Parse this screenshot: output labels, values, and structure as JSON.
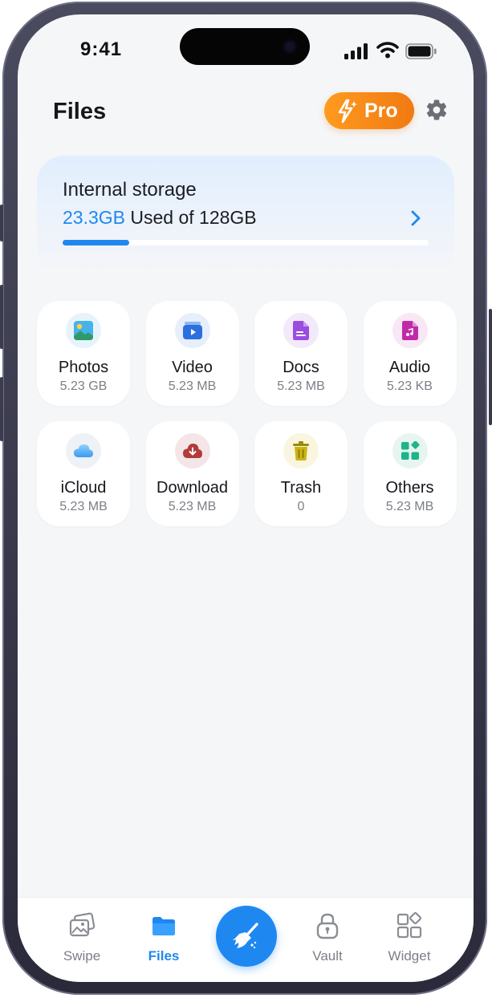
{
  "status_bar": {
    "time": "9:41"
  },
  "header": {
    "title": "Files",
    "pro_label": "Pro"
  },
  "storage": {
    "label": "Internal storage",
    "used_amount": "23.3GB",
    "used_suffix": " Used of 128GB",
    "used_fraction": 0.182
  },
  "categories": [
    {
      "name": "Photos",
      "size": "5.23 GB",
      "icon": "photos-icon",
      "tint": "#e7f3fb"
    },
    {
      "name": "Video",
      "size": "5.23 MB",
      "icon": "video-icon",
      "tint": "#e6effb"
    },
    {
      "name": "Docs",
      "size": "5.23 MB",
      "icon": "docs-icon",
      "tint": "#f2e9fa"
    },
    {
      "name": "Audio",
      "size": "5.23 KB",
      "icon": "audio-icon",
      "tint": "#f8e7f4"
    },
    {
      "name": "iCloud",
      "size": "5.23 MB",
      "icon": "icloud-icon",
      "tint": "#eef1f6"
    },
    {
      "name": "Download",
      "size": "5.23 MB",
      "icon": "download-icon",
      "tint": "#f4e6e6"
    },
    {
      "name": "Trash",
      "size": "0",
      "icon": "trash-icon",
      "tint": "#faf5df"
    },
    {
      "name": "Others",
      "size": "5.23 MB",
      "icon": "others-icon",
      "tint": "#e6f5f0"
    }
  ],
  "tabbar": {
    "swipe": "Swipe",
    "files": "Files",
    "vault": "Vault",
    "widget": "Widget"
  },
  "colors": {
    "accent": "#1e88f0",
    "pro": "#f07a12"
  }
}
